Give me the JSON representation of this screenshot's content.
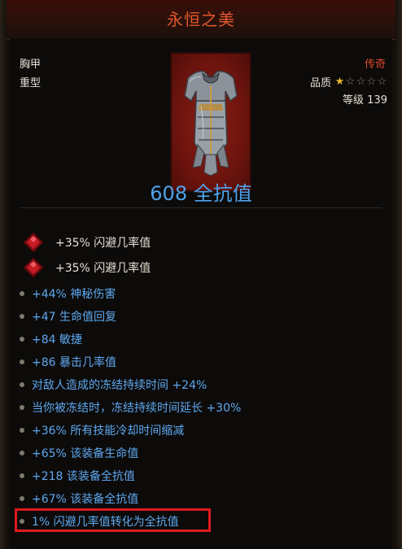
{
  "item": {
    "name": "永恒之美",
    "slot": "胸甲",
    "weight_class": "重型",
    "rarity": "传奇",
    "quality_label": "品质",
    "quality_stars": 1,
    "quality_max": 5,
    "level_label": "等级",
    "level": "139",
    "armor_value": "608 全抗值"
  },
  "gems": [
    {
      "icon": "red-gem-icon",
      "text": "+35% 闪避几率值"
    },
    {
      "icon": "red-gem-icon",
      "text": "+35% 闪避几率值"
    }
  ],
  "affixes": [
    "+44% 神秘伤害",
    "+47 生命值回复",
    "+84 敏捷",
    "+86 暴击几率值",
    "对敌人造成的冻结持续时间 +24%",
    "当你被冻结时，冻结持续时间延长 +30%",
    "+36% 所有技能冷却时间缩减",
    "+65% 该装备生命值",
    "+218 该装备全抗值",
    "+67% 该装备全抗值",
    "1% 闪避几率值转化为全抗值"
  ],
  "colors": {
    "title": "#e2572a",
    "rarity": "#e0482a",
    "armor": "#4fa3ec",
    "affix": "#5fa8f0",
    "highlight": "#e0191c"
  }
}
